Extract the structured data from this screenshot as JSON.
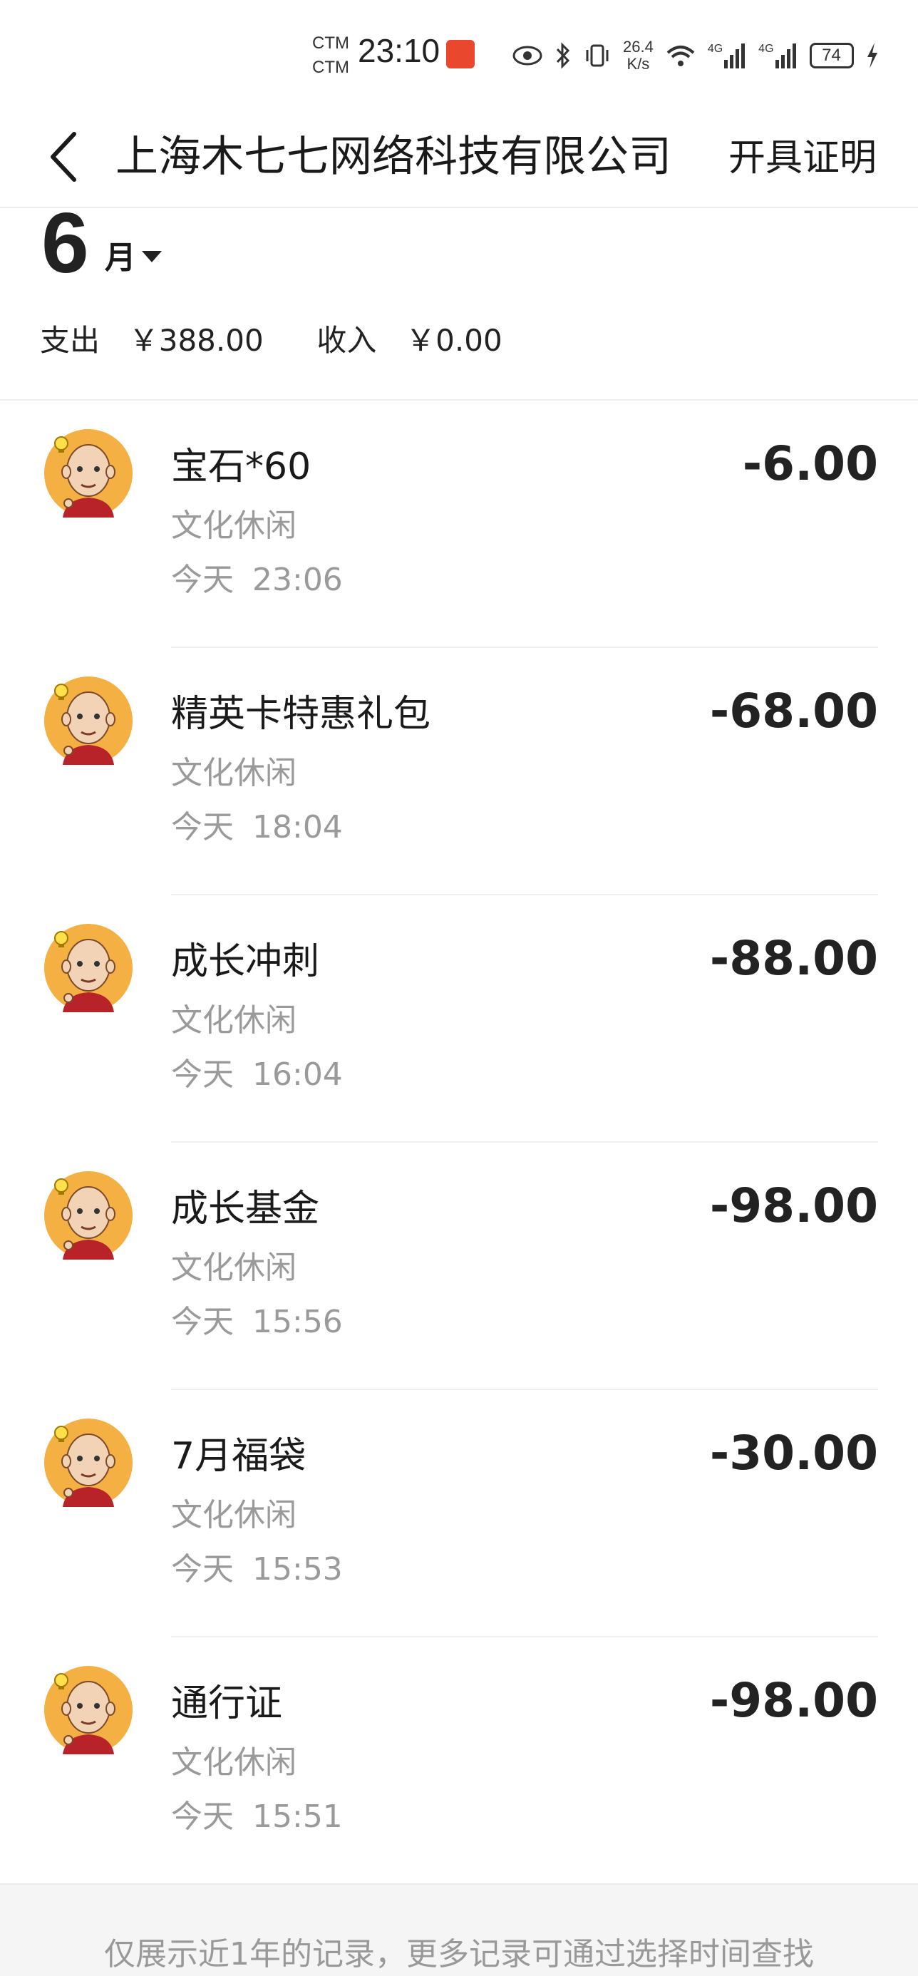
{
  "status_bar": {
    "carrier_top": "CTM",
    "carrier_bottom": "CTM",
    "time": "23:10",
    "net_speed_value": "26.4",
    "net_speed_unit": "K/s",
    "network_label_1": "4G",
    "network_label_2": "4G",
    "battery": "74",
    "icons": [
      "eye-icon",
      "bluetooth-icon",
      "vibrate-icon",
      "wifi-icon",
      "signal-icon",
      "signal-icon",
      "battery-icon",
      "charging-icon"
    ]
  },
  "nav": {
    "back_icon": "chevron-left-icon",
    "title": "上海木七七网络科技有限公司",
    "action": "开具证明"
  },
  "month": {
    "number": "6",
    "unit": "月"
  },
  "summary": {
    "expense_label": "支出",
    "expense_value": "￥388.00",
    "income_label": "收入",
    "income_value": "￥0.00"
  },
  "transactions": [
    {
      "name": "宝石*60",
      "category": "文化休闲",
      "day": "今天",
      "time": "23:06",
      "amount": "-6.00"
    },
    {
      "name": "精英卡特惠礼包",
      "category": "文化休闲",
      "day": "今天",
      "time": "18:04",
      "amount": "-68.00"
    },
    {
      "name": "成长冲刺",
      "category": "文化休闲",
      "day": "今天",
      "time": "16:04",
      "amount": "-88.00"
    },
    {
      "name": "成长基金",
      "category": "文化休闲",
      "day": "今天",
      "time": "15:56",
      "amount": "-98.00"
    },
    {
      "name": "7月福袋",
      "category": "文化休闲",
      "day": "今天",
      "time": "15:53",
      "amount": "-30.00"
    },
    {
      "name": "通行证",
      "category": "文化休闲",
      "day": "今天",
      "time": "15:51",
      "amount": "-98.00"
    }
  ],
  "footer": {
    "note": "仅展示近1年的记录，更多记录可通过选择时间查找"
  },
  "colors": {
    "avatar_bg": "#f4b043",
    "text_primary": "#1a1a1a",
    "text_secondary": "#9a9a9a",
    "footer_bg": "#f5f5f5"
  }
}
